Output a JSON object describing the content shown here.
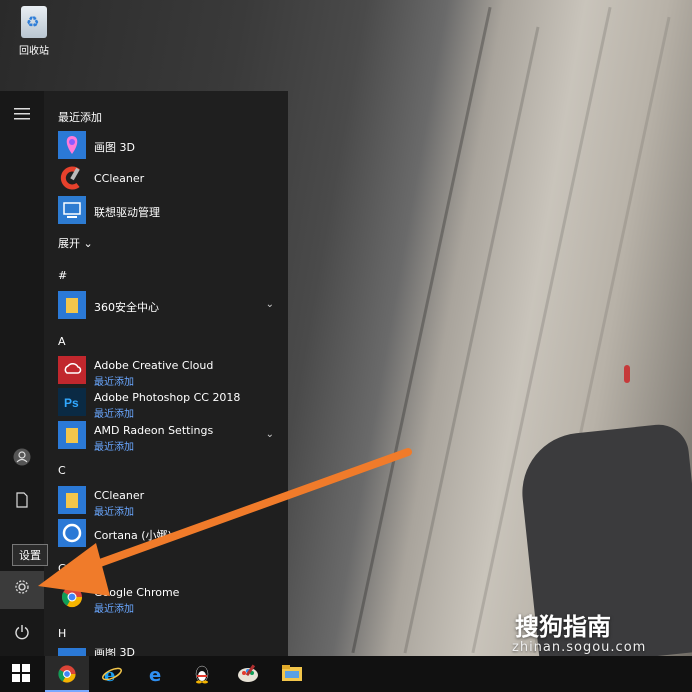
{
  "desktop": {
    "recycle_label": "回收站"
  },
  "start_menu": {
    "recent_heading": "最近添加",
    "recent_items": [
      {
        "label": "画图 3D"
      },
      {
        "label": "CCleaner"
      },
      {
        "label": "联想驱动管理"
      }
    ],
    "expand_label": "展开 ⌄",
    "sections": {
      "hash": "#",
      "a": "A",
      "c": "C",
      "g": "G",
      "h": "H"
    },
    "apps": [
      {
        "label": "360安全中心",
        "sub": ""
      },
      {
        "label": "Adobe Creative Cloud",
        "sub": "最近添加"
      },
      {
        "label": "Adobe Photoshop CC 2018",
        "sub": "最近添加"
      },
      {
        "label": "AMD Radeon Settings",
        "sub": "最近添加"
      },
      {
        "label": "CCleaner",
        "sub": "最近添加"
      },
      {
        "label": "Cortana (小娜)",
        "sub": ""
      },
      {
        "label": "Google Chrome",
        "sub": "最近添加"
      },
      {
        "label": "画图 3D",
        "sub": ""
      }
    ],
    "tooltip": "设置"
  },
  "watermark": {
    "brand": "搜狗指南",
    "url": "zhinan.sogou.com"
  },
  "colors": {
    "accent_link": "#6aa7ff",
    "folder_tile": "#f3c64b",
    "arrow": "#f07b2a"
  }
}
